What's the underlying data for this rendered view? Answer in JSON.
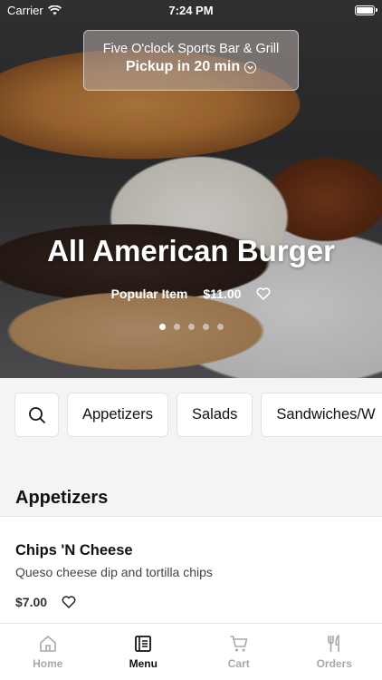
{
  "status_bar": {
    "carrier": "Carrier",
    "time": "7:24 PM"
  },
  "header": {
    "restaurant_name": "Five O'clock Sports Bar & Grill",
    "pickup_text": "Pickup in 20 min"
  },
  "featured": {
    "title": "All American Burger",
    "tag": "Popular Item",
    "price": "$11.00",
    "slide_count": 5,
    "active_slide": 1
  },
  "categories": [
    "Appetizers",
    "Salads",
    "Sandwiches/W"
  ],
  "section": {
    "title": "Appetizers"
  },
  "menu_item": {
    "name": "Chips 'N Cheese",
    "description": "Queso cheese dip and tortilla chips",
    "price": "$7.00"
  },
  "tabs": [
    {
      "label": "Home",
      "icon": "home-icon",
      "active": false
    },
    {
      "label": "Menu",
      "icon": "menu-icon",
      "active": true
    },
    {
      "label": "Cart",
      "icon": "cart-icon",
      "active": false
    },
    {
      "label": "Orders",
      "icon": "fork-knife-icon",
      "active": false
    }
  ]
}
